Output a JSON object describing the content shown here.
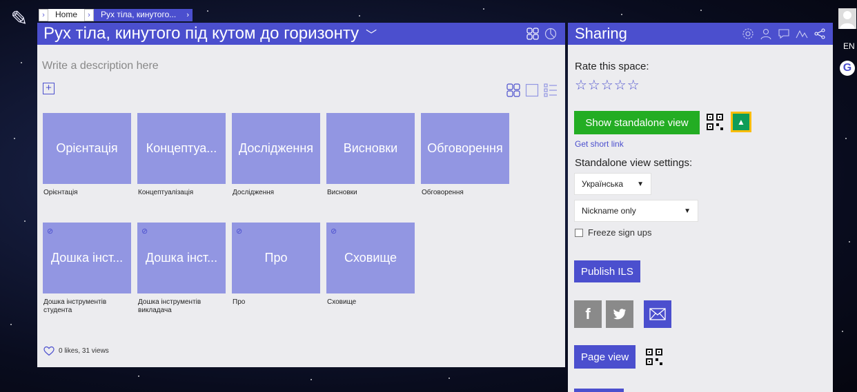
{
  "breadcrumb": {
    "home": "Home",
    "current": "Рух тіла, кинутого..."
  },
  "main": {
    "title": "Рух тіла, кинутого під кутом до горизонту",
    "description_placeholder": "Write a description here",
    "tiles_row1": [
      {
        "label": "Орієнтація",
        "caption": "Орієнтація"
      },
      {
        "label": "Концептуа...",
        "caption": "Концептуалізація"
      },
      {
        "label": "Дослідження",
        "caption": "Дослідження"
      },
      {
        "label": "Висновки",
        "caption": "Висновки"
      },
      {
        "label": "Обговорення",
        "caption": "Обговорення"
      }
    ],
    "tiles_row2": [
      {
        "label": "Дошка інст...",
        "caption": "Дошка інструментів студента"
      },
      {
        "label": "Дошка інст...",
        "caption": "Дошка інструментів викладача"
      },
      {
        "label": "Про",
        "caption": "Про"
      },
      {
        "label": "Сховище",
        "caption": "Сховище"
      }
    ],
    "likes_text": "0 likes, 31 views"
  },
  "sharing": {
    "title": "Sharing",
    "rate_label": "Rate this space:",
    "stars": "☆☆☆☆☆",
    "standalone_button": "Show standalone view",
    "short_link": "Get short link",
    "standalone_settings_label": "Standalone view settings:",
    "language_select": "Українська",
    "nickname_select": "Nickname only",
    "freeze_label": "Freeze sign ups",
    "publish_button": "Publish ILS",
    "page_view_button": "Page view"
  },
  "right_strip": {
    "language": "EN"
  },
  "colors": {
    "accent": "#4b4fce",
    "tile": "#9296e2",
    "green": "#23ad23",
    "panel_bg": "#ececef"
  }
}
